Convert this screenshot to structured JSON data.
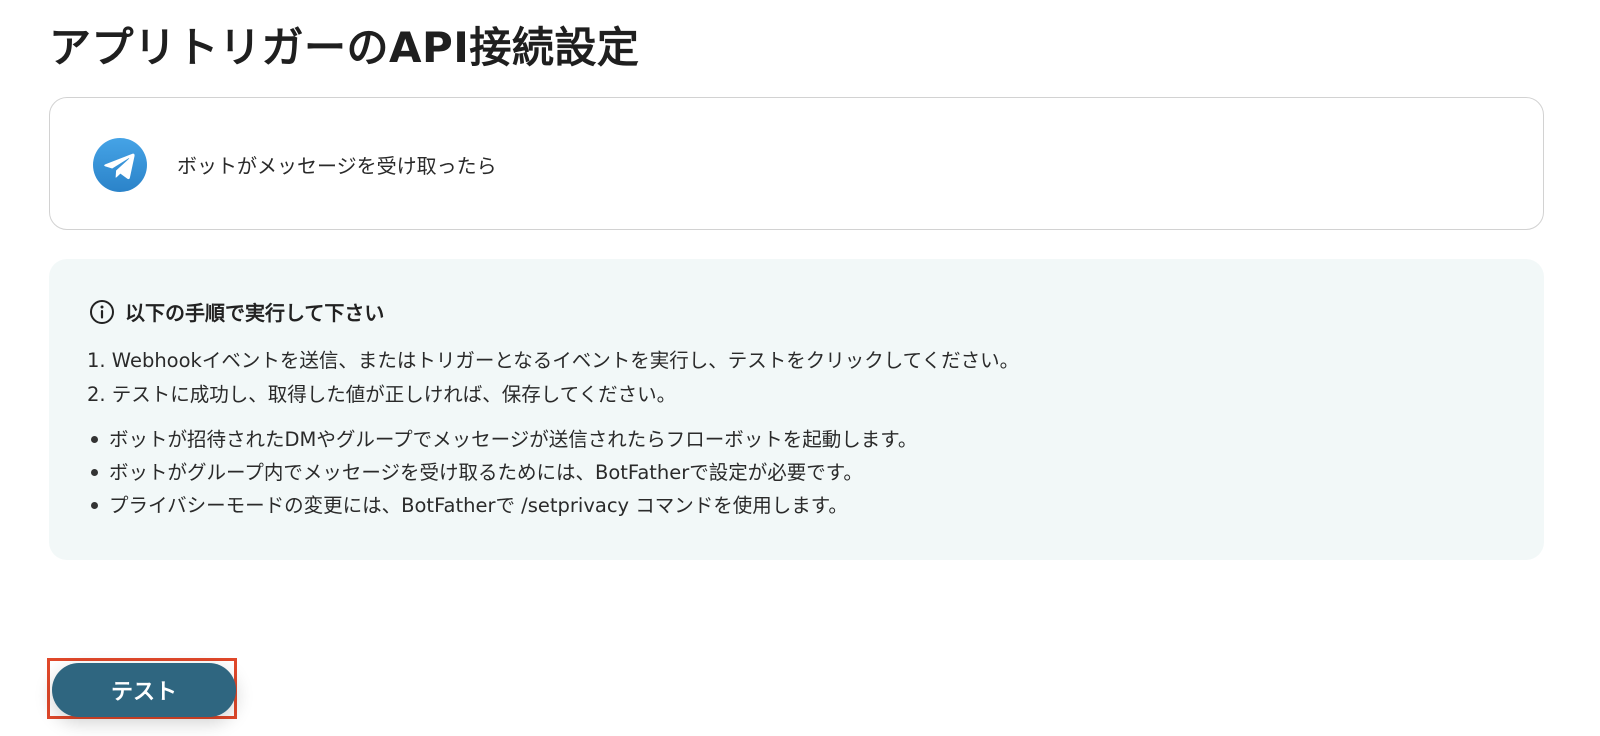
{
  "page": {
    "title": "アプリトリガーのAPI接続設定"
  },
  "trigger": {
    "app_icon": "telegram-icon",
    "label": "ボットがメッセージを受け取ったら"
  },
  "info": {
    "icon": "info-circle-icon",
    "heading": "以下の手順で実行して下さい",
    "steps": [
      "1. Webhookイベントを送信、またはトリガーとなるイベントを実行し、テストをクリックしてください。",
      "2. テストに成功し、取得した値が正しければ、保存してください。"
    ],
    "notes": [
      "ボットが招待されたDMやグループでメッセージが送信されたらフローボットを起動します。",
      "ボットがグループ内でメッセージを受け取るためには、BotFatherで設定が必要です。",
      "プライバシーモードの変更には、BotFatherで /setprivacy コマンドを使用します。"
    ]
  },
  "actions": {
    "test_label": "テスト"
  },
  "colors": {
    "panel_background": "#f2f8f8",
    "button_background": "#2f6680",
    "highlight_border": "#e0482a",
    "telegram_blue": "#3a8fd6"
  }
}
